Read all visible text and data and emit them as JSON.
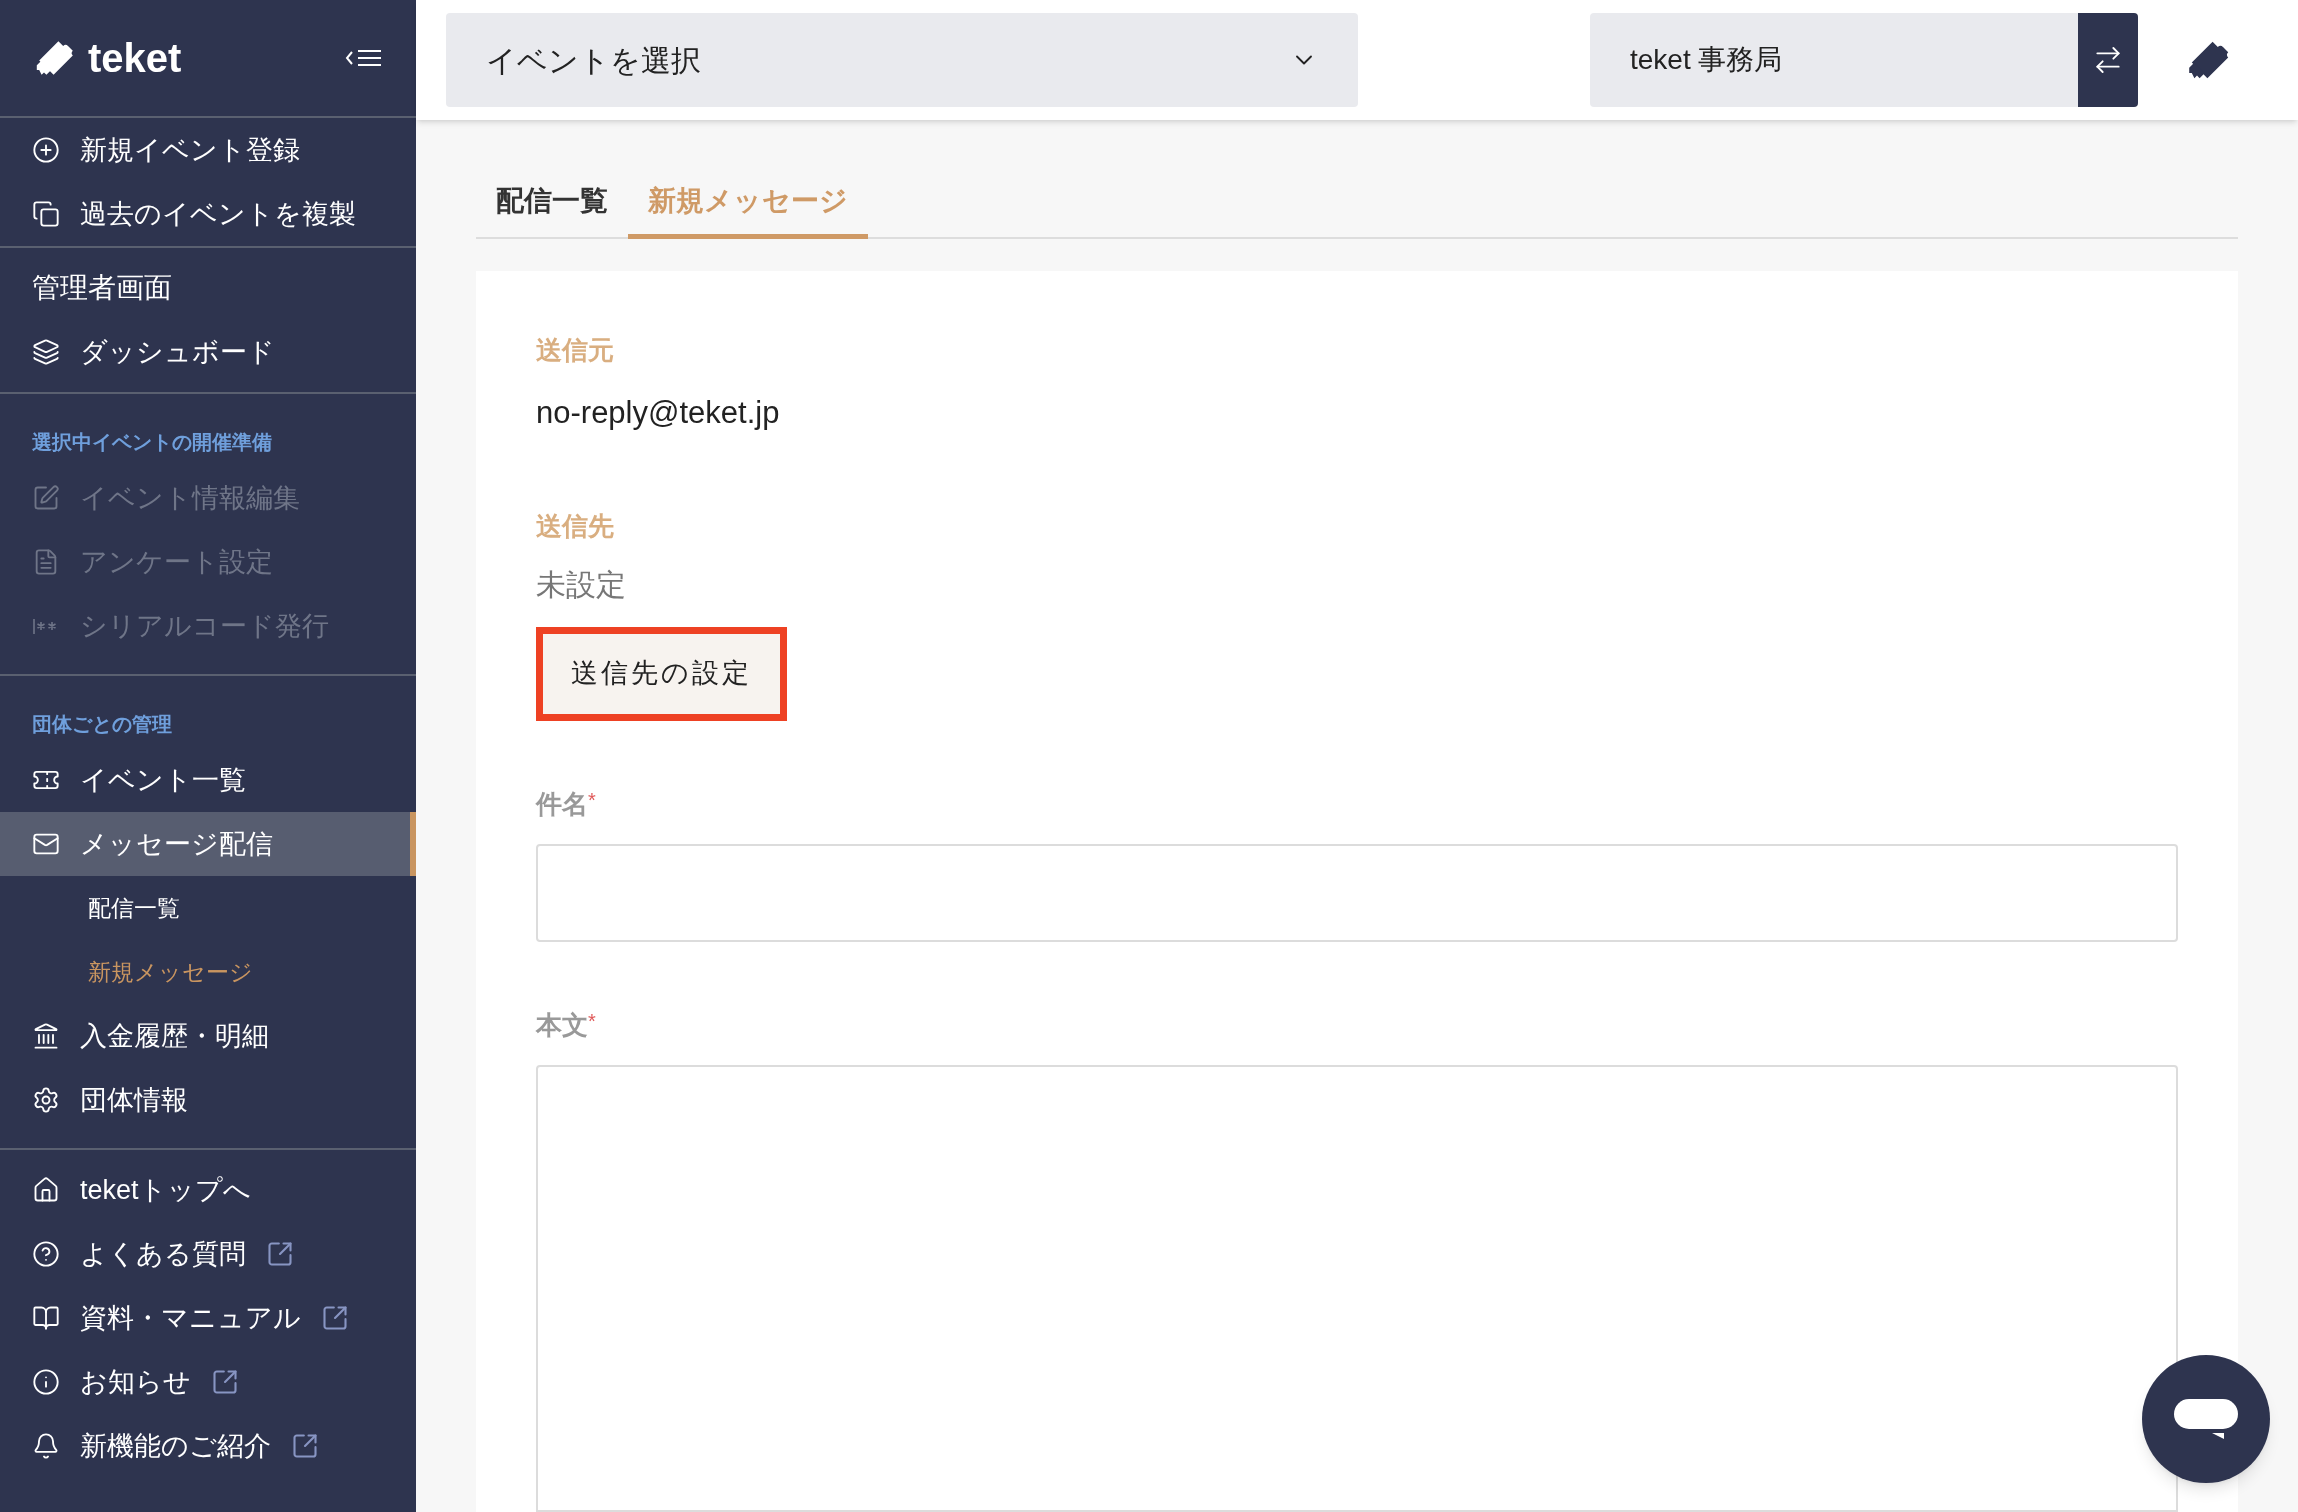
{
  "sidebar": {
    "logo": "teket",
    "groups": [
      {
        "items": [
          {
            "label": "新規イベント登録",
            "kind": "item",
            "disabled": false,
            "selected": false,
            "external": false
          },
          {
            "label": "過去のイベントを複製",
            "kind": "item",
            "disabled": false,
            "selected": false,
            "external": false
          }
        ]
      },
      {
        "items": [
          {
            "label": "管理者画面",
            "kind": "title",
            "disabled": false,
            "selected": false,
            "external": false
          },
          {
            "label": "ダッシュボード",
            "kind": "item",
            "disabled": false,
            "selected": false,
            "external": false
          }
        ]
      },
      {
        "heading": "選択中イベントの開催準備",
        "items": [
          {
            "label": "イベント情報編集",
            "kind": "item",
            "disabled": true,
            "selected": false,
            "external": false
          },
          {
            "label": "アンケート設定",
            "kind": "item",
            "disabled": true,
            "selected": false,
            "external": false
          },
          {
            "label": "シリアルコード発行",
            "kind": "item",
            "disabled": true,
            "selected": false,
            "external": false
          }
        ]
      },
      {
        "heading": "団体ごとの管理",
        "items": [
          {
            "label": "イベント一覧",
            "kind": "item",
            "disabled": false,
            "selected": false,
            "external": false
          },
          {
            "label": "メッセージ配信",
            "kind": "item",
            "disabled": false,
            "selected": true,
            "external": false,
            "children": [
              {
                "label": "配信一覧",
                "selected": false
              },
              {
                "label": "新規メッセージ",
                "selected": true
              }
            ]
          },
          {
            "label": "入金履歴・明細",
            "kind": "item",
            "disabled": false,
            "selected": false,
            "external": false
          },
          {
            "label": "団体情報",
            "kind": "item",
            "disabled": false,
            "selected": false,
            "external": false
          }
        ]
      },
      {
        "items": [
          {
            "label": "teketトップへ",
            "kind": "item",
            "disabled": false,
            "selected": false,
            "external": false
          },
          {
            "label": "よくある質問",
            "kind": "item",
            "disabled": false,
            "selected": false,
            "external": true
          },
          {
            "label": "資料・マニュアル",
            "kind": "item",
            "disabled": false,
            "selected": false,
            "external": true
          },
          {
            "label": "お知らせ",
            "kind": "item",
            "disabled": false,
            "selected": false,
            "external": true
          },
          {
            "label": "新機能のご紹介",
            "kind": "item",
            "disabled": false,
            "selected": false,
            "external": true
          }
        ]
      }
    ]
  },
  "header": {
    "event_select": {
      "value": "イベントを選択"
    },
    "organization": {
      "value": "teket 事務局"
    }
  },
  "tabs": [
    {
      "label": "配信一覧",
      "selected": false
    },
    {
      "label": "新規メッセージ",
      "selected": true
    }
  ],
  "form": {
    "sender": {
      "label": "送信元",
      "value": "no-reply@teket.jp"
    },
    "recipient": {
      "label": "送信先",
      "value": "未設定",
      "button": "送信先の設定"
    },
    "fields": [
      {
        "label": "件名",
        "required_mark": "*",
        "kind": "input"
      },
      {
        "label": "本文",
        "required_mark": "*",
        "kind": "textarea"
      }
    ]
  }
}
